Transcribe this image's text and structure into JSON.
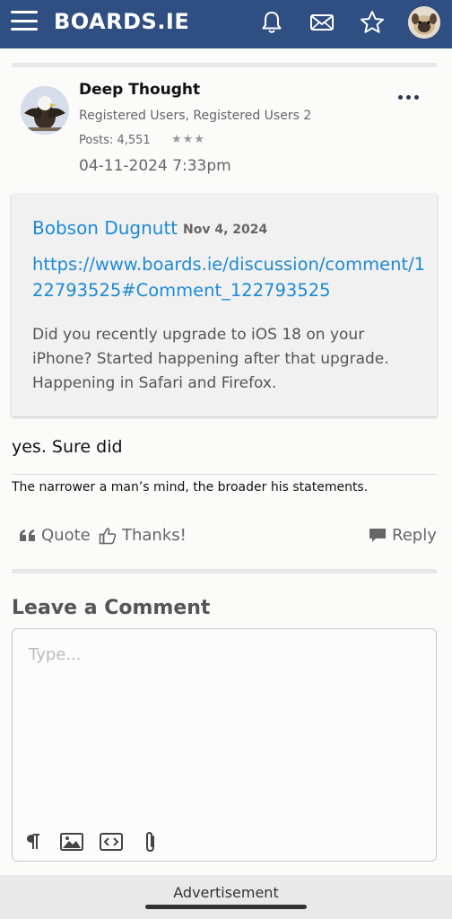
{
  "header": {
    "logo": "BOARDS.IE"
  },
  "post": {
    "author_name": "Deep Thought",
    "author_roles": "Registered Users, Registered Users 2",
    "posts_count": "Posts: 4,551",
    "rank_stars": "★★★",
    "date": "04-11-2024 7:33pm",
    "quote": {
      "author": "Bobson Dugnutt",
      "date": "Nov 4, 2024",
      "link": "https://www.boards.ie/discussion/comment/122793525#Comment_122793525",
      "text": "Did you recently upgrade to iOS 18 on your iPhone? Started happening after that upgrade. Happening in Safari and Firefox."
    },
    "body": "yes. Sure did",
    "signature": "The narrower a man’s mind, the broader his statements."
  },
  "actions": {
    "quote": "Quote",
    "thanks": "Thanks!",
    "reply": "Reply"
  },
  "comment": {
    "title": "Leave a Comment",
    "placeholder": "Type..."
  },
  "footer": {
    "ad_label": "Advertisement"
  },
  "colors": {
    "header_bg": "#2f4f83",
    "link": "#1d8ad6"
  }
}
